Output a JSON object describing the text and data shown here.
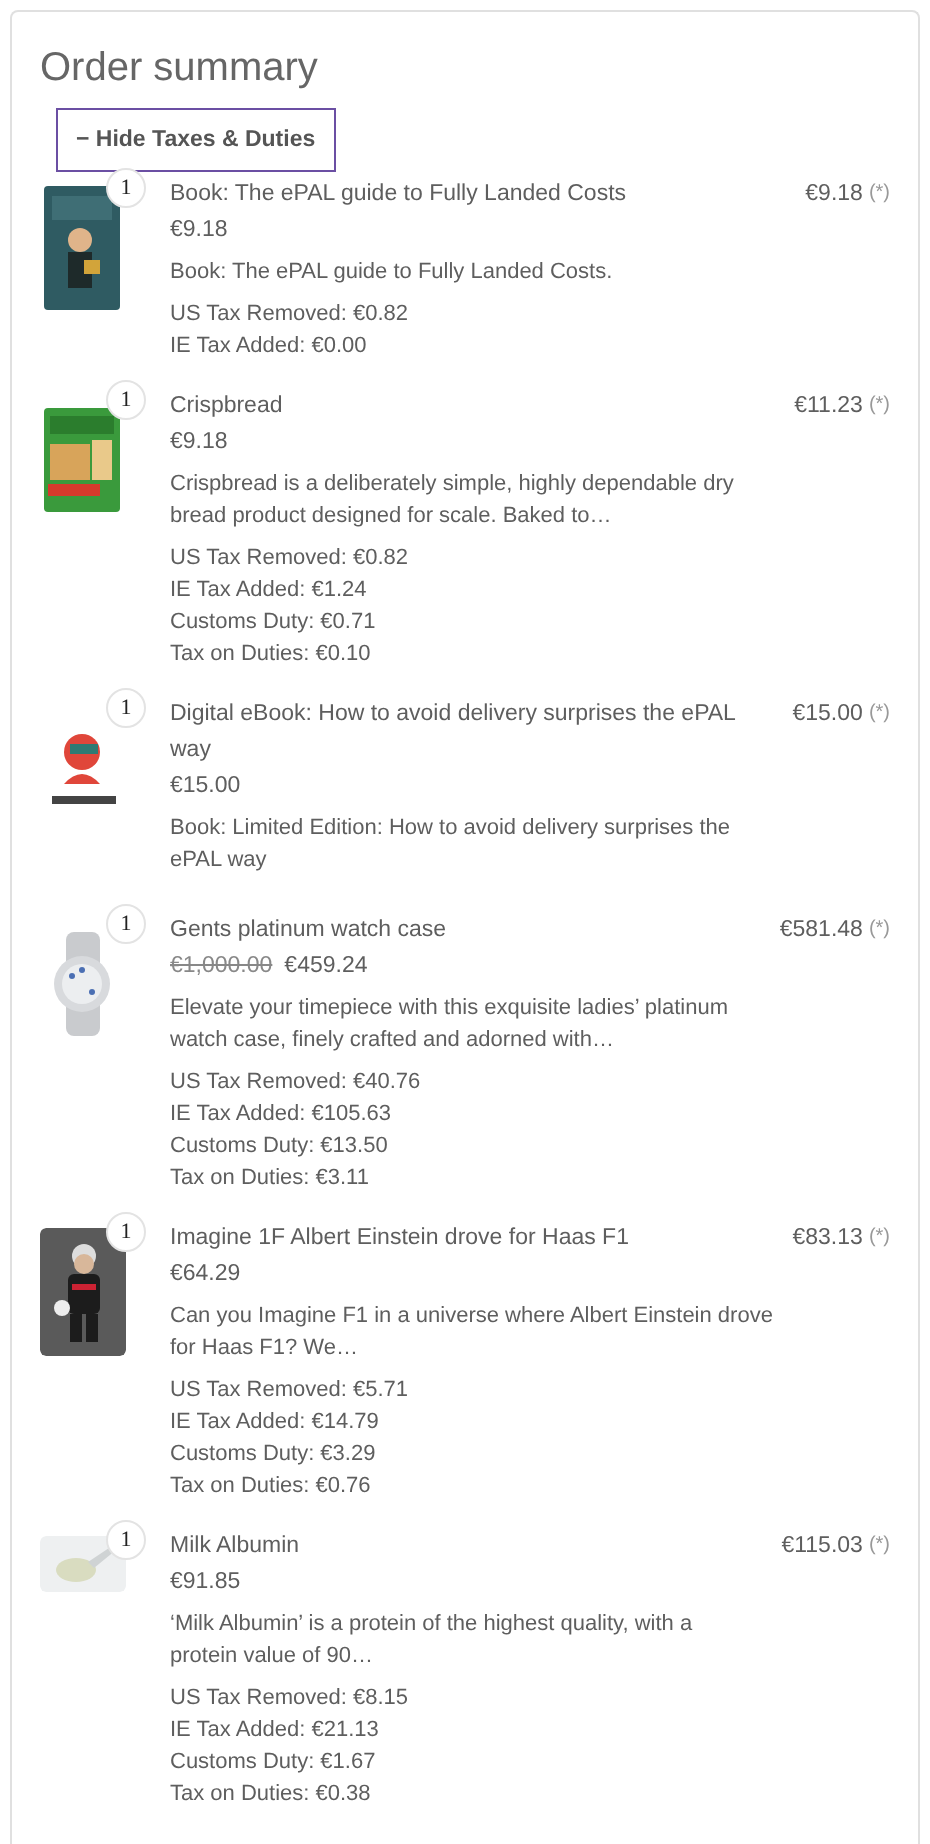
{
  "title": "Order summary",
  "toggle": {
    "label": "− Hide Taxes & Duties"
  },
  "items": [
    {
      "quantity": "1",
      "name": "Book: The ePAL guide to Fully Landed Costs",
      "price": "€9.18",
      "description": "Book: The ePAL guide to Fully Landed Costs.",
      "taxes": [
        "US Tax Removed: €0.82",
        "IE Tax Added: €0.00"
      ],
      "total": "€9.18",
      "note": "(*)"
    },
    {
      "quantity": "1",
      "name": "Crispbread",
      "price": "€9.18",
      "description": "Crispbread is a deliberately simple, highly dependable dry bread product designed for scale. Baked to…",
      "taxes": [
        "US Tax Removed: €0.82",
        "IE Tax Added: €1.24",
        "Customs Duty: €0.71",
        "Tax on Duties: €0.10"
      ],
      "total": "€11.23",
      "note": "(*)"
    },
    {
      "quantity": "1",
      "name": "Digital eBook: How to avoid delivery surprises the ePAL way",
      "price": "€15.00",
      "description": "Book: Limited Edition: How to avoid delivery surprises the ePAL way",
      "total": "€15.00",
      "note": "(*)"
    },
    {
      "quantity": "1",
      "name": "Gents platinum watch case",
      "original_price": "€1,000.00",
      "price": "€459.24",
      "description": "Elevate your timepiece with this exquisite ladies’ platinum watch case, finely crafted and adorned with…",
      "taxes": [
        "US Tax Removed: €40.76",
        "IE Tax Added: €105.63",
        "Customs Duty: €13.50",
        "Tax on Duties: €3.11"
      ],
      "total": "€581.48",
      "note": "(*)"
    },
    {
      "quantity": "1",
      "name": "Imagine 1F Albert Einstein drove for Haas F1",
      "price": "€64.29",
      "description": "Can you Imagine F1 in a universe where Albert Einstein drove for Haas F1? We…",
      "taxes": [
        "US Tax Removed: €5.71",
        "IE Tax Added: €14.79",
        "Customs Duty: €3.29",
        "Tax on Duties: €0.76"
      ],
      "total": "€83.13",
      "note": "(*)"
    },
    {
      "quantity": "1",
      "name": "Milk Albumin",
      "price": "€91.85",
      "description": "‘Milk Albumin’ is a protein of the highest quality, with a protein value of 90…",
      "taxes": [
        "US Tax Removed: €8.15",
        "IE Tax Added: €21.13",
        "Customs Duty: €1.67",
        "Tax on Duties: €0.38"
      ],
      "total": "€115.03",
      "note": "(*)"
    }
  ]
}
